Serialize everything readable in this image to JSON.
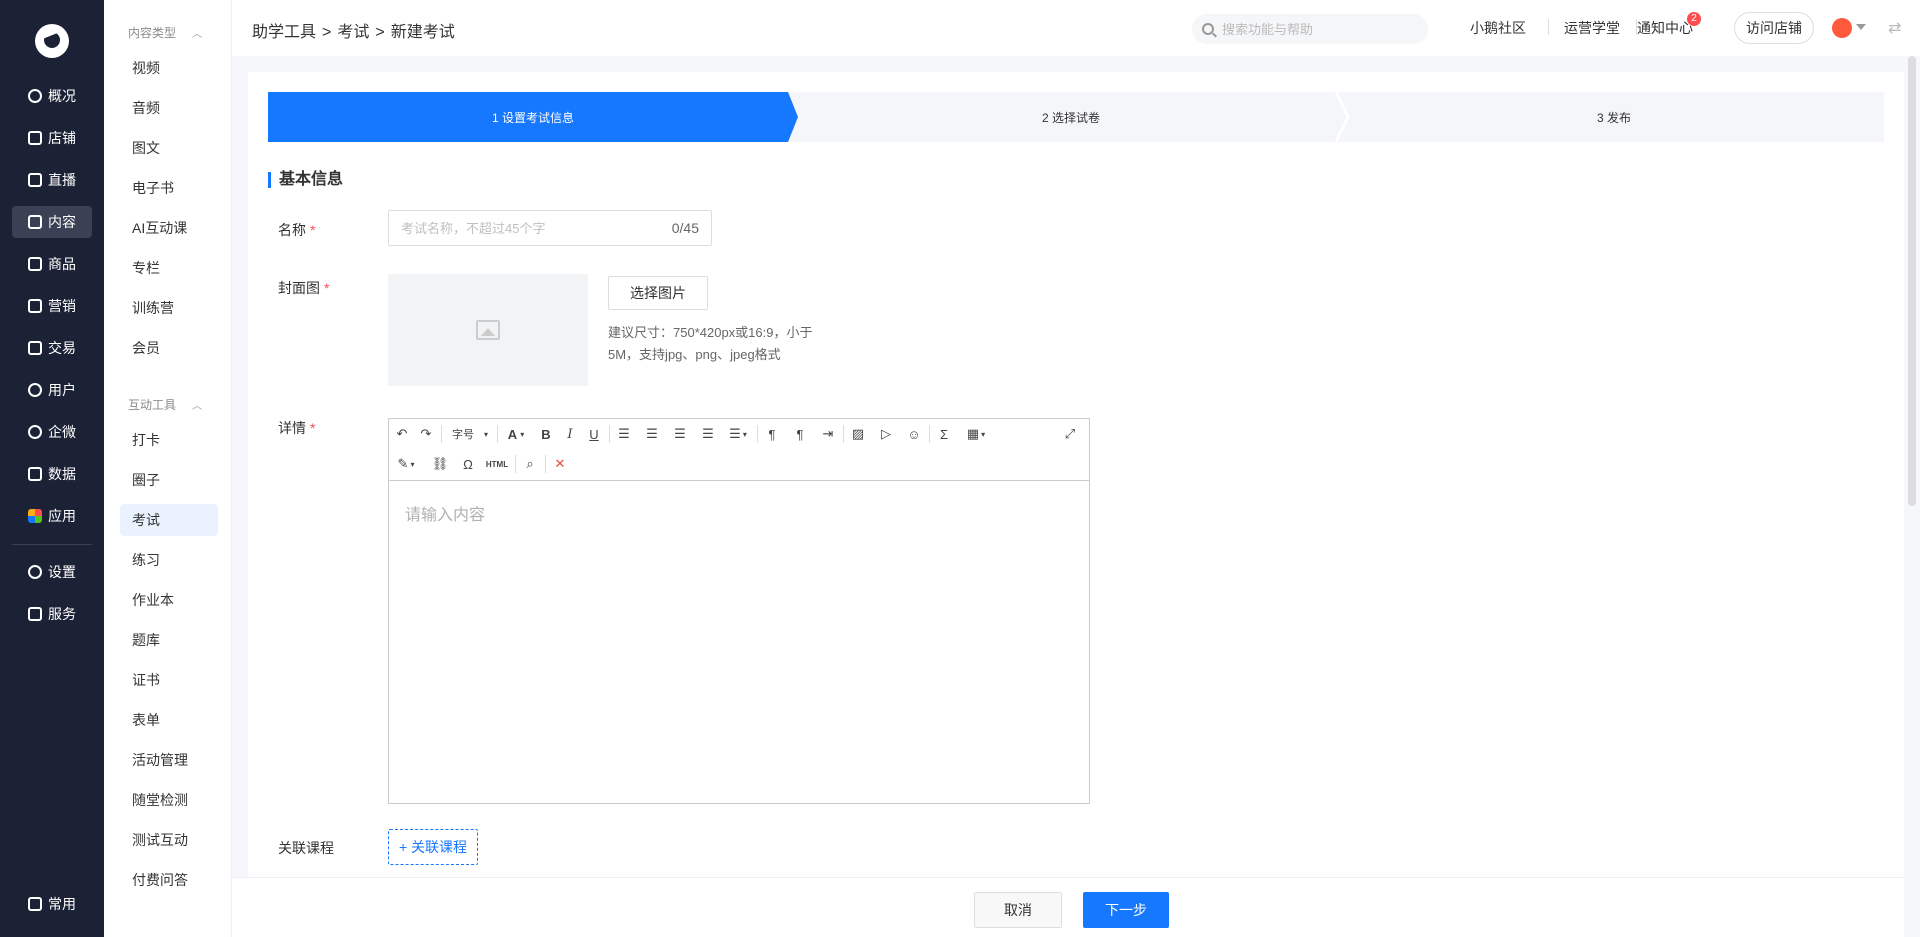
{
  "nav": {
    "items": [
      {
        "label": "概况",
        "icon": "overview-icon"
      },
      {
        "label": "店铺",
        "icon": "shop-icon"
      },
      {
        "label": "直播",
        "icon": "live-icon"
      },
      {
        "label": "内容",
        "icon": "content-icon",
        "active": true
      },
      {
        "label": "商品",
        "icon": "product-icon"
      },
      {
        "label": "营销",
        "icon": "marketing-icon"
      },
      {
        "label": "交易",
        "icon": "trade-icon"
      },
      {
        "label": "用户",
        "icon": "user-icon"
      },
      {
        "label": "企微",
        "icon": "wecom-icon"
      },
      {
        "label": "数据",
        "icon": "data-icon"
      },
      {
        "label": "应用",
        "icon": "apps-icon"
      },
      {
        "label": "设置",
        "icon": "settings-icon"
      },
      {
        "label": "服务",
        "icon": "service-icon"
      },
      {
        "label": "常用",
        "icon": "menu-icon"
      }
    ]
  },
  "subnav": {
    "group1": "内容类型",
    "group1_items": [
      "视频",
      "音频",
      "图文",
      "电子书",
      "AI互动课",
      "专栏",
      "训练营",
      "会员"
    ],
    "group2": "互动工具",
    "group2_items": [
      "打卡",
      "圈子",
      "考试",
      "练习",
      "作业本",
      "题库",
      "证书",
      "表单",
      "活动管理",
      "随堂检测",
      "测试互动",
      "付费问答"
    ],
    "active": "考试"
  },
  "header": {
    "breadcrumb": [
      "助学工具",
      ">",
      "考试",
      ">",
      "新建考试"
    ],
    "search_placeholder": "搜索功能与帮助",
    "links": [
      "小鹅社区",
      "运营学堂",
      "通知中心"
    ],
    "notify_count": "2",
    "visit_label": "访问店铺",
    "swap_icon": "swap-icon"
  },
  "steps": [
    "1 设置考试信息",
    "2 选择试卷",
    "3 发布"
  ],
  "form": {
    "section_title": "基本信息",
    "name_label": "名称",
    "name_placeholder": "考试名称，不超过45个字",
    "name_count": "0/45",
    "cover_label": "封面图",
    "cover_button": "选择图片",
    "cover_hint": "建议尺寸：750*420px或16:9，小于5M，支持jpg、png、jpeg格式",
    "detail_label": "详情",
    "toolbar_font_size": "字号",
    "toolbar_html": "HTML",
    "editor_placeholder": "请输入内容",
    "course_label": "关联课程",
    "course_button": "+ 关联课程",
    "required_mark": "*"
  },
  "footer": {
    "cancel": "取消",
    "next": "下一步"
  },
  "colors": {
    "primary": "#1677ff",
    "nav_bg": "#1c2236",
    "required": "#ff4d4f"
  }
}
